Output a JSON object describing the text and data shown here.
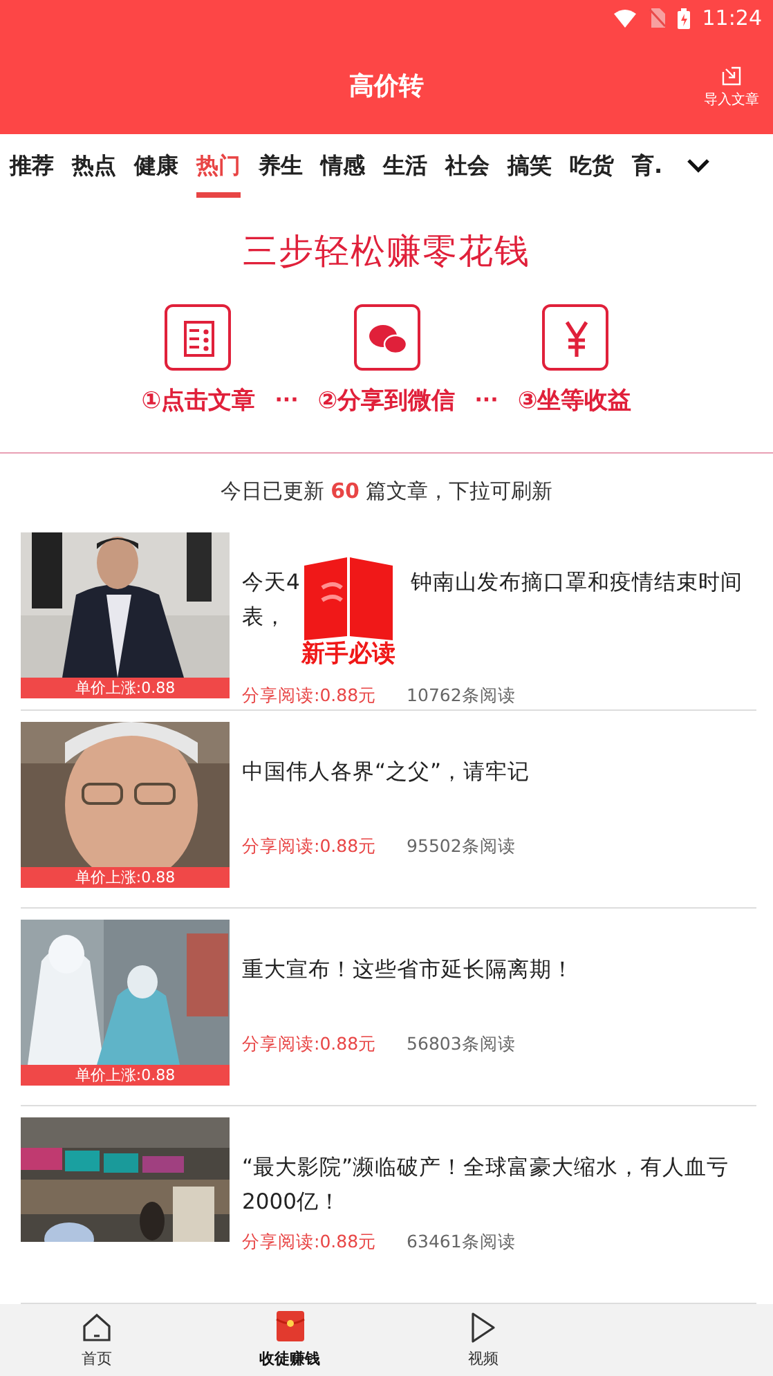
{
  "status_bar": {
    "time": "11:24"
  },
  "header": {
    "title": "高价转",
    "action": "导入文章"
  },
  "tabs": [
    {
      "label": "推荐",
      "selected": false
    },
    {
      "label": "热点",
      "selected": false
    },
    {
      "label": "健康",
      "selected": false
    },
    {
      "label": "热门",
      "selected": true
    },
    {
      "label": "养生",
      "selected": false
    },
    {
      "label": "情感",
      "selected": false
    },
    {
      "label": "生活",
      "selected": false
    },
    {
      "label": "社会",
      "selected": false
    },
    {
      "label": "搞笑",
      "selected": false
    },
    {
      "label": "吃货",
      "selected": false
    },
    {
      "label": "育.",
      "selected": false
    }
  ],
  "banner": {
    "title": "三步轻松赚零花钱",
    "steps": [
      {
        "kind": "article",
        "label": "①点击文章"
      },
      {
        "kind": "chat",
        "label": "②分享到微信"
      },
      {
        "kind": "yuan",
        "label": "③坐等收益"
      }
    ],
    "separator": "···"
  },
  "update_notice": "今日已更新 **60** 篇文章，下拉可刷新",
  "articles": [
    {
      "title_parts": [
        "今天4",
        "钟南山发布摘口罩和疫情结束时间",
        "表，"
      ],
      "price_tag": "单价上涨:0.88",
      "reward": "分享阅读:0.88元",
      "reads": "10762条阅读"
    },
    {
      "title_parts": [
        "中国伟人各界“之父”，请牢记"
      ],
      "price_tag": "单价上涨:0.88",
      "reward": "分享阅读:0.88元",
      "reads": "95502条阅读"
    },
    {
      "title_parts": [
        "重大宣布！这些省市延长隔离期！"
      ],
      "price_tag": "单价上涨:0.88",
      "reward": "分享阅读:0.88元",
      "reads": "56803条阅读"
    },
    {
      "title_parts": [
        "“最大影院”濒临破产！全球富豪大缩水，有人血亏2000亿！"
      ],
      "reward": "分享阅读:0.88元",
      "reads": "63461条阅读"
    }
  ],
  "overlay_badge": {
    "label": "新手必读"
  },
  "bottom_nav": [
    {
      "kind": "home",
      "label": "首页",
      "selected": false
    },
    {
      "kind": "redpacket",
      "label": "收徒赚钱",
      "selected": true
    },
    {
      "kind": "play",
      "label": "视频",
      "selected": false
    }
  ]
}
